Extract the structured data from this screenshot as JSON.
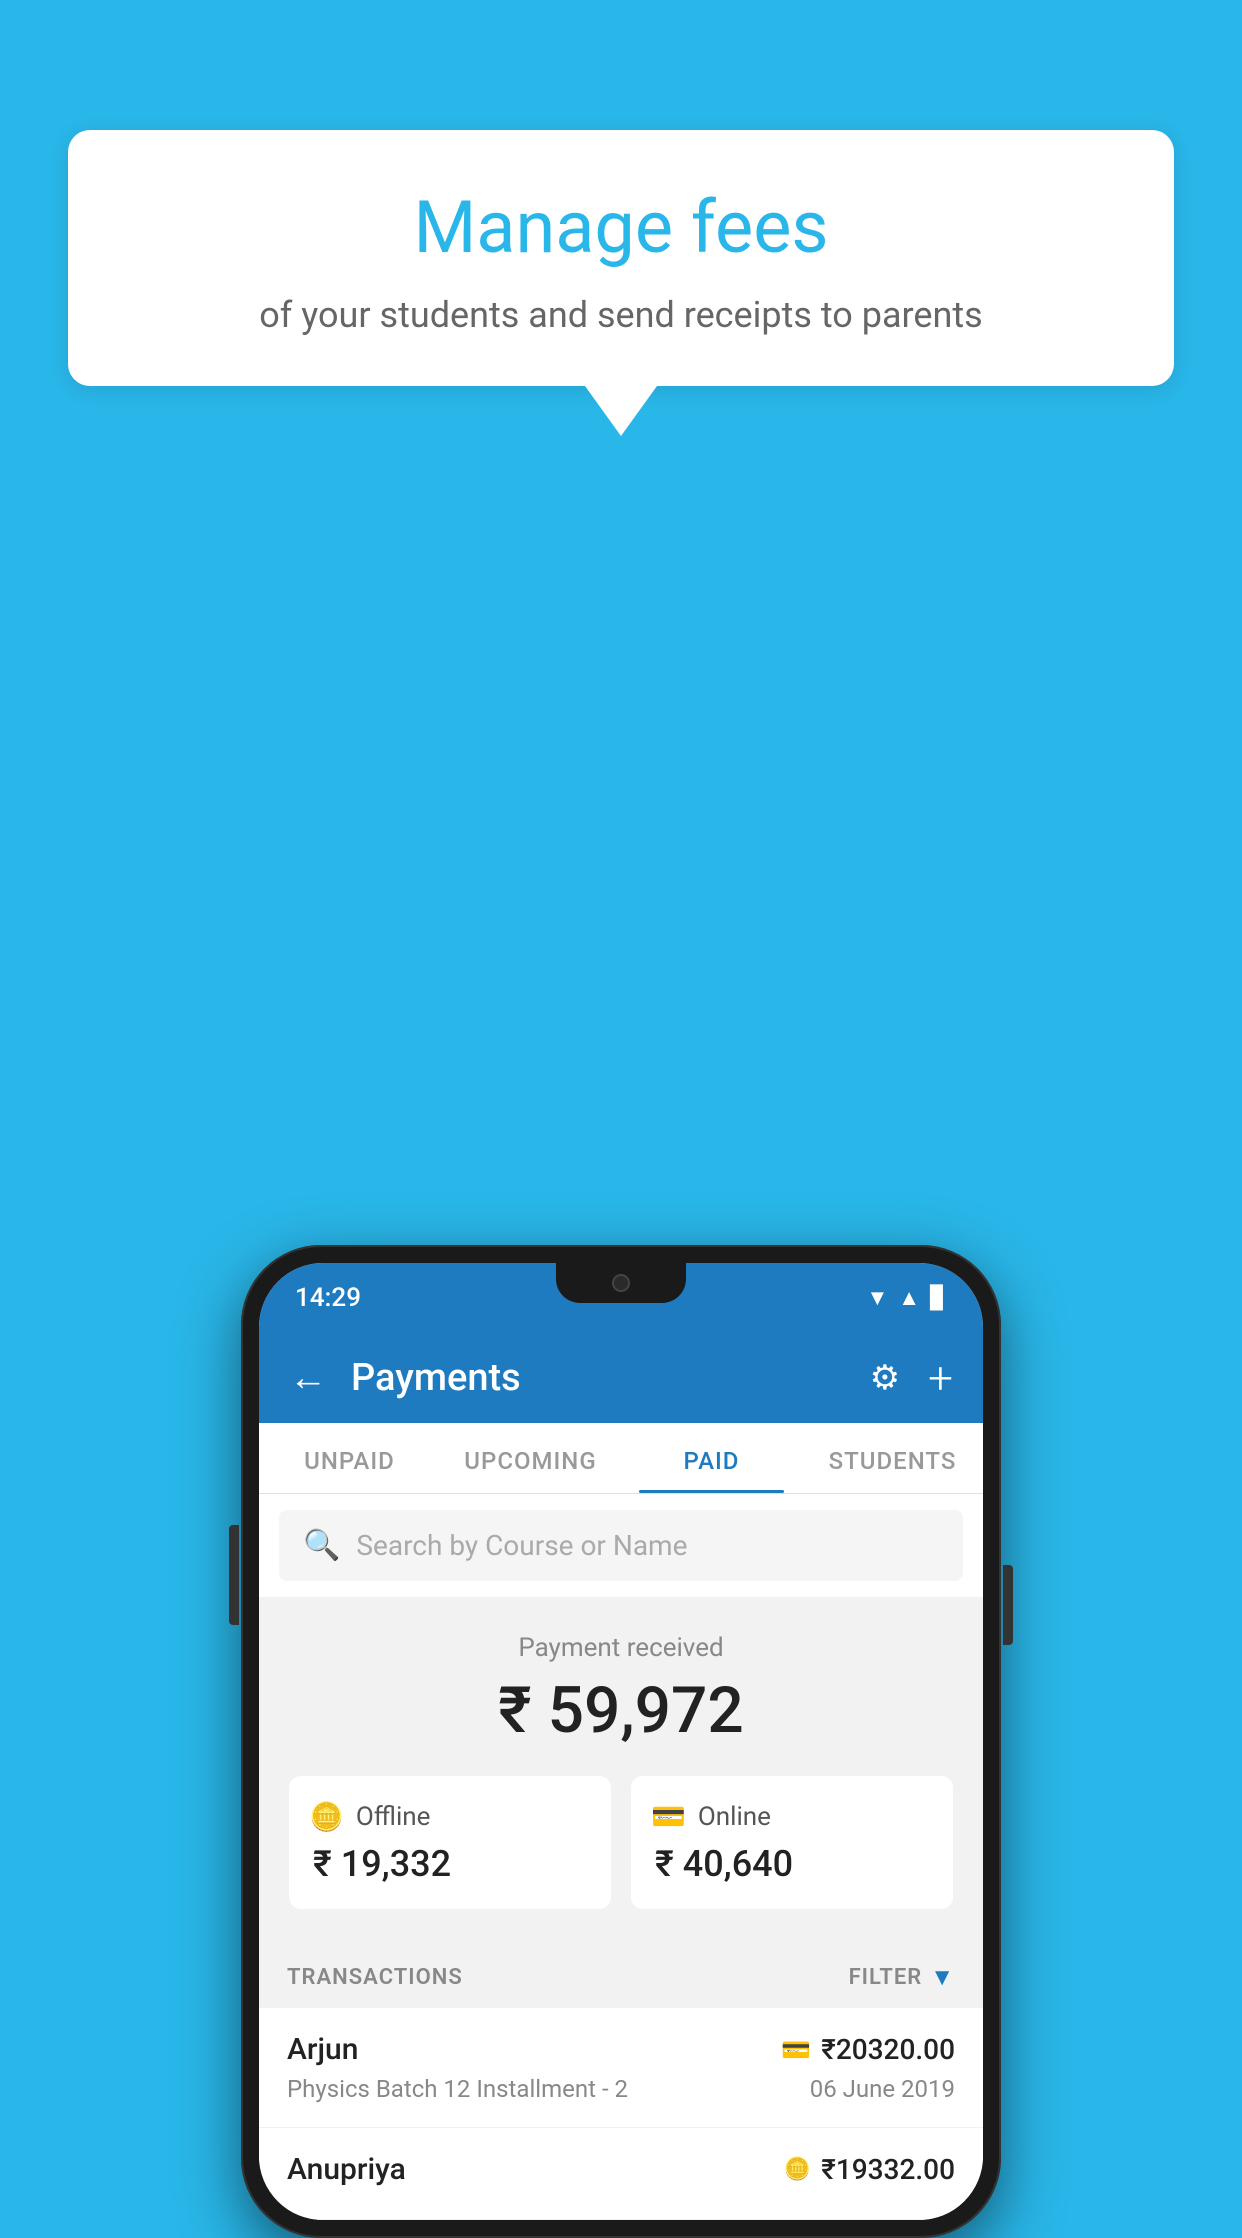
{
  "background_color": "#29b6e8",
  "speech_bubble": {
    "title": "Manage fees",
    "subtitle": "of your students and send receipts to parents"
  },
  "phone": {
    "status_bar": {
      "time": "14:29",
      "wifi": "▲",
      "signal": "▲",
      "battery": "▊"
    },
    "header": {
      "back_label": "←",
      "title": "Payments",
      "settings_icon": "⚙",
      "add_icon": "+"
    },
    "tabs": [
      {
        "label": "UNPAID",
        "active": false
      },
      {
        "label": "UPCOMING",
        "active": false
      },
      {
        "label": "PAID",
        "active": true
      },
      {
        "label": "STUDENTS",
        "active": false
      }
    ],
    "search": {
      "placeholder": "Search by Course or Name"
    },
    "payment_summary": {
      "received_label": "Payment received",
      "total_amount": "₹ 59,972",
      "offline": {
        "label": "Offline",
        "amount": "₹ 19,332"
      },
      "online": {
        "label": "Online",
        "amount": "₹ 40,640"
      }
    },
    "transactions": {
      "section_label": "TRANSACTIONS",
      "filter_label": "FILTER",
      "items": [
        {
          "name": "Arjun",
          "course": "Physics Batch 12 Installment - 2",
          "amount": "₹20320.00",
          "date": "06 June 2019",
          "payment_type": "online"
        },
        {
          "name": "Anupriya",
          "course": "",
          "amount": "₹19332.00",
          "date": "",
          "payment_type": "offline"
        }
      ]
    }
  }
}
